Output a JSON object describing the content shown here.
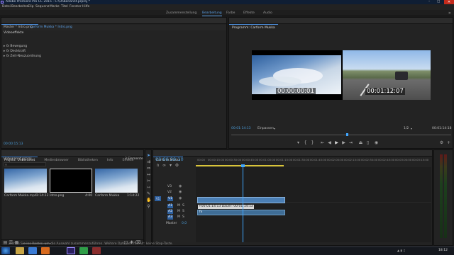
{
  "app": {
    "title": "Adobe Premiere Pro CC 2015 - C:\\Unbenannt.prproj *",
    "menu": [
      "Datei",
      "Bearbeiten",
      "Clip",
      "Sequenz",
      "Marke",
      "Titel",
      "Fenster",
      "Hilfe"
    ]
  },
  "workspaces": [
    "Zusammenstellung",
    "Bearbeitung",
    "Farbe",
    "Effekte",
    "Audio"
  ],
  "workspace_active": "Bearbeitung",
  "effect_controls": {
    "tabs": [
      "Effekteinstellungen",
      "Audioclip-Mischer: Carform Mukka",
      "Metadaten",
      "Quelle: (keine Clips)"
    ],
    "master": "Master * Intro.png",
    "clip": "Carform Mukka * Intro.png",
    "section": "Videoeffekte",
    "effects": [
      "Bewegung",
      "Deckkraft",
      "Zeit-Neuzuordnung"
    ],
    "timecode": "00:00:15:13"
  },
  "program": {
    "title": "Programm: Carform Mukka",
    "overlay_left": "00:00:00:01",
    "overlay_right": "00:01:12:07",
    "timecode_current": "00:01:14:13",
    "fit": "Einpassen",
    "quality": "1/2",
    "timecode_total": "00:01:14:18"
  },
  "project": {
    "tabs": [
      "Projekt: Unbenannt",
      "Medienbrowser",
      "Bibliotheken",
      "Info",
      "Effekte"
    ],
    "file": "Unbenannt.prproj",
    "count": "3 Elemente",
    "items": [
      {
        "name": "Carform Mukka.mp4",
        "duration": "1:14:22"
      },
      {
        "name": "Intro.png",
        "duration": "4:00"
      },
      {
        "name": "Carform Mukka",
        "duration": "1:14:22"
      }
    ]
  },
  "timeline": {
    "tab": "Carform Mukka",
    "timecode": "00:00:39:10",
    "ruler": [
      "00:00",
      "00:00:15:00",
      "00:00:30:00",
      "00:00:45:00",
      "00:01:00:00",
      "00:01:15:00",
      "00:01:30:00",
      "00:01:45:00",
      "00:02:00:00",
      "00:02:15:00",
      "00:02:30:00",
      "00:02:45:00",
      "00:03:00:00",
      "00:03:15:00"
    ],
    "tracks": [
      "V3",
      "V2",
      "V1",
      "A1",
      "A2",
      "A3"
    ],
    "master": "Master",
    "master_value": "0,0",
    "clip_tooltip": "+00:01:14:13  Dauer: 00:01:14:13",
    "clip_label": "fx"
  },
  "status_text": "Ziehen Sie ins Raster, um die Auswahl zusammenzuführen. Weitere Optionen mit Alt: keine Stop-Taste.",
  "clock": "18:12",
  "colors": {
    "video_clip": "#4b7fb5",
    "audio_clip": "#3f6d96",
    "accent": "#4a8ad6",
    "playhead": "#3fa6ff"
  }
}
